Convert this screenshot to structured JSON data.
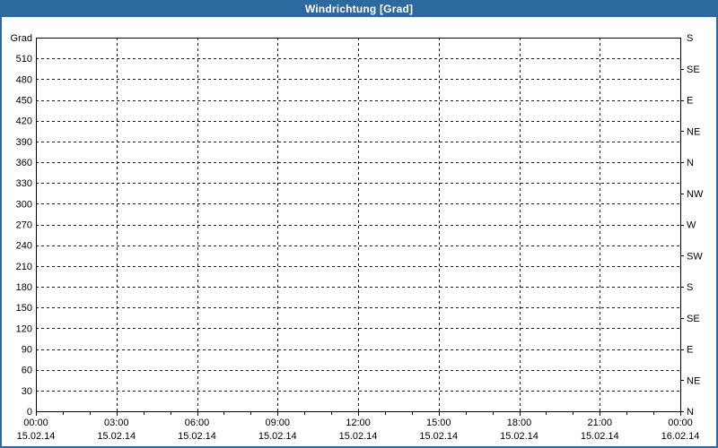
{
  "window": {
    "title": "Windrichtung [Grad]"
  },
  "colors": {
    "titlebar_bg": "#2b699e",
    "titlebar_text": "#ffffff",
    "window_border": "#2b699e",
    "plot_background": "#ffffff",
    "grid_line": "#1b1b1b",
    "axis_line": "#000000",
    "label_text": "#000000"
  },
  "chart_data": {
    "type": "line",
    "title": "Windrichtung [Grad]",
    "series": [],
    "x_axis": {
      "tick_times": [
        "00:00",
        "03:00",
        "06:00",
        "09:00",
        "12:00",
        "15:00",
        "18:00",
        "21:00",
        "00:00"
      ],
      "tick_dates": [
        "15.02.14",
        "15.02.14",
        "15.02.14",
        "15.02.14",
        "15.02.14",
        "15.02.14",
        "15.02.14",
        "15.02.14",
        "16.02.14"
      ],
      "range_hours": [
        0,
        24
      ],
      "major_tick_interval_hours": 3,
      "minor_tick_interval_hours": 1
    },
    "y_axis_left": {
      "unit_label": "Grad",
      "min": 0,
      "max": 540,
      "tick_step": 30,
      "tick_labels": [
        "0",
        "30",
        "60",
        "90",
        "120",
        "150",
        "180",
        "210",
        "240",
        "270",
        "300",
        "330",
        "360",
        "390",
        "420",
        "450",
        "480",
        "510"
      ]
    },
    "y_axis_right": {
      "tick_step": 45,
      "labels_bottom_to_top": [
        "N",
        "NE",
        "E",
        "SE",
        "S",
        "SW",
        "W",
        "NW",
        "N",
        "NE",
        "E",
        "SE",
        "S"
      ]
    },
    "grid": {
      "style": "dashed",
      "horizontal_step": 30,
      "vertical_step_hours": 3
    }
  }
}
